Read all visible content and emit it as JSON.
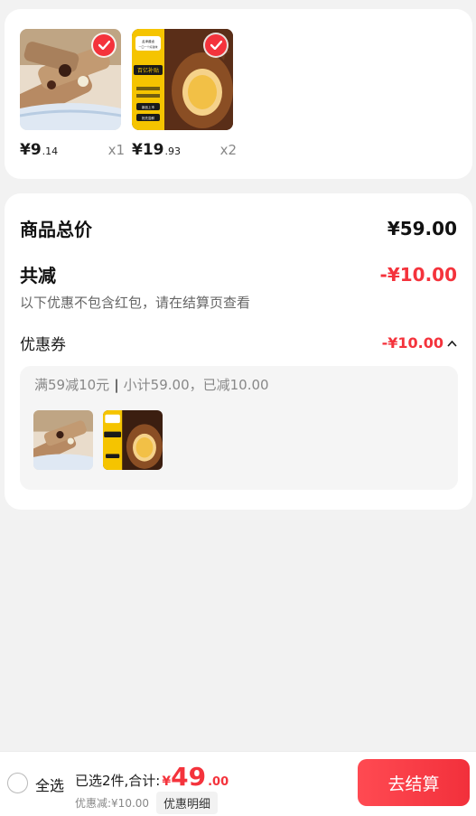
{
  "products": [
    {
      "price_int": "¥9",
      "price_dec": ".14",
      "qty": "x1",
      "image": "wafer-roll-snack"
    },
    {
      "price_int": "¥19",
      "price_dec": ".93",
      "qty": "x2",
      "image": "braised-egg-snack"
    }
  ],
  "product_badge_text": {
    "line1": "孟津酱卤",
    "line2": "一口一个好滋味",
    "main": "百亿补贴",
    "small1": "蛋香饱满 口感软糯",
    "small2": "鲜香入味",
    "btn1": "新品上市",
    "btn2": "抢先尝鲜"
  },
  "summary": {
    "total_label": "商品总价",
    "total_value": "¥59.00",
    "reduce_label": "共减",
    "reduce_value": "-¥10.00",
    "note": "以下优惠不包含红包，请在结算页查看",
    "coupon_label": "优惠券",
    "coupon_value": "-¥10.00",
    "coupon_desc_a": "满59减10元",
    "coupon_desc_sep": "|",
    "coupon_desc_b": "小计59.00，已减10.00"
  },
  "bottom": {
    "select_all": "全选",
    "selected_text": "已选2件,合计:",
    "total_symbol": "¥",
    "total_int": "49",
    "total_dec": ".00",
    "discount_text": "优惠减:¥10.00",
    "detail_btn": "优惠明细",
    "checkout": "去结算"
  },
  "colors": {
    "accent": "#f4333c",
    "background": "#f2f2f2"
  }
}
